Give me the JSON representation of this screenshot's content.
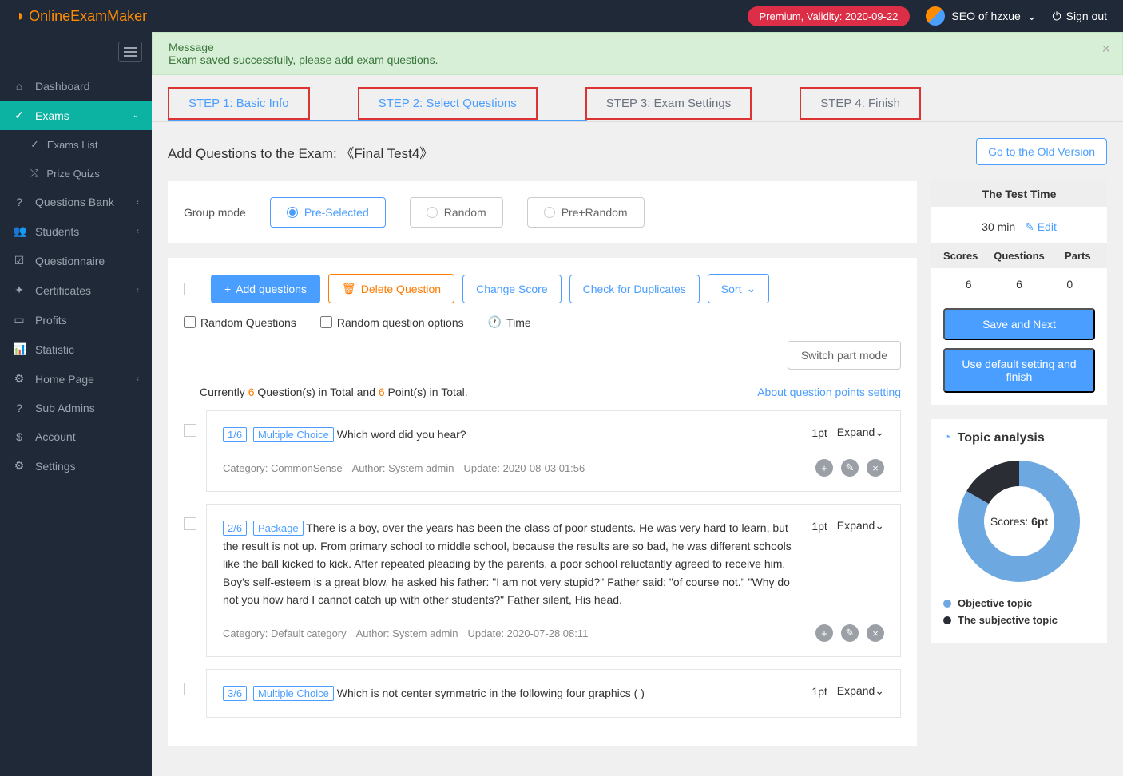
{
  "topbar": {
    "logo_text": "OnlineExamMaker",
    "premium": "Premium, Validity: 2020-09-22",
    "user": "SEO of hzxue",
    "signout": "Sign out"
  },
  "sidebar": {
    "dashboard": "Dashboard",
    "exams": "Exams",
    "exams_list": "Exams List",
    "prize_quizs": "Prize Quizs",
    "questions_bank": "Questions Bank",
    "students": "Students",
    "questionnaire": "Questionnaire",
    "certificates": "Certificates",
    "profits": "Profits",
    "statistic": "Statistic",
    "home_page": "Home Page",
    "sub_admins": "Sub Admins",
    "account": "Account",
    "settings": "Settings"
  },
  "message": {
    "title": "Message",
    "body": "Exam saved successfully, please add exam questions."
  },
  "steps": {
    "s1": "STEP 1: Basic Info",
    "s2": "STEP 2: Select Questions",
    "s3": "STEP 3: Exam Settings",
    "s4": "STEP 4: Finish"
  },
  "page": {
    "title_prefix": "Add Questions to the Exam: ",
    "exam_name": "《Final Test4》",
    "old_version": "Go to the Old Version"
  },
  "group_mode": {
    "label": "Group mode",
    "pre_selected": "Pre-Selected",
    "random": "Random",
    "pre_random": "Pre+Random"
  },
  "toolbar": {
    "add": "Add questions",
    "delete": "Delete Question",
    "change_score": "Change Score",
    "check_dup": "Check for Duplicates",
    "sort": "Sort",
    "random_q": "Random Questions",
    "random_opt": "Random question options",
    "time": "Time",
    "switch_part": "Switch part mode"
  },
  "summary": {
    "pre1": "Currently ",
    "count_q": "6",
    "mid1": " Question(s) in Total and ",
    "count_p": "6",
    "mid2": " Point(s) in Total.",
    "about": "About question points setting"
  },
  "questions": [
    {
      "num": "1/6",
      "tag": "Multiple Choice",
      "text": "Which word did you hear?",
      "pts": "1pt",
      "expand": "Expand",
      "category": "Category: CommonSense",
      "author": "Author: System admin",
      "update": "Update: 2020-08-03 01:56"
    },
    {
      "num": "2/6",
      "tag": "Package",
      "text": "There is a boy, over the years has been the class of poor students. He was very hard to learn, but the result is not up. From primary school to middle school, because the results are so bad, he was different schools like the ball kicked to kick. After repeated pleading by the parents, a poor school reluctantly agreed to receive him.\n        Boy's self-esteem is a great blow, he asked his father: \"I am not very stupid?\" Father said: \"of course not.\" \"Why do not you how hard I cannot catch up with other students?\" Father silent, His head.",
      "pts": "1pt",
      "expand": "Expand",
      "category": "Category: Default category",
      "author": "Author: System admin",
      "update": "Update: 2020-07-28 08:11"
    },
    {
      "num": "3/6",
      "tag": "Multiple Choice",
      "text": "Which is not center symmetric in the following four graphics ( )",
      "pts": "1pt",
      "expand": "Expand",
      "category": "",
      "author": "",
      "update": ""
    }
  ],
  "side": {
    "test_time_header": "The Test Time",
    "test_time": "30 min",
    "edit": "Edit",
    "scores_h": "Scores",
    "questions_h": "Questions",
    "parts_h": "Parts",
    "scores_v": "6",
    "questions_v": "6",
    "parts_v": "0",
    "save_next": "Save and Next",
    "use_default": "Use default setting and finish",
    "topic_title": "Topic analysis",
    "donut_label": "Scores: ",
    "donut_value": "6pt",
    "legend1": "Objective topic",
    "legend2": "The subjective topic"
  },
  "chart_data": {
    "type": "pie",
    "title": "Topic analysis",
    "series": [
      {
        "name": "Objective topic",
        "value": 5,
        "color": "#6ea8e0"
      },
      {
        "name": "The subjective topic",
        "value": 1,
        "color": "#2a2e34"
      }
    ],
    "center_label": "Scores: 6pt"
  }
}
